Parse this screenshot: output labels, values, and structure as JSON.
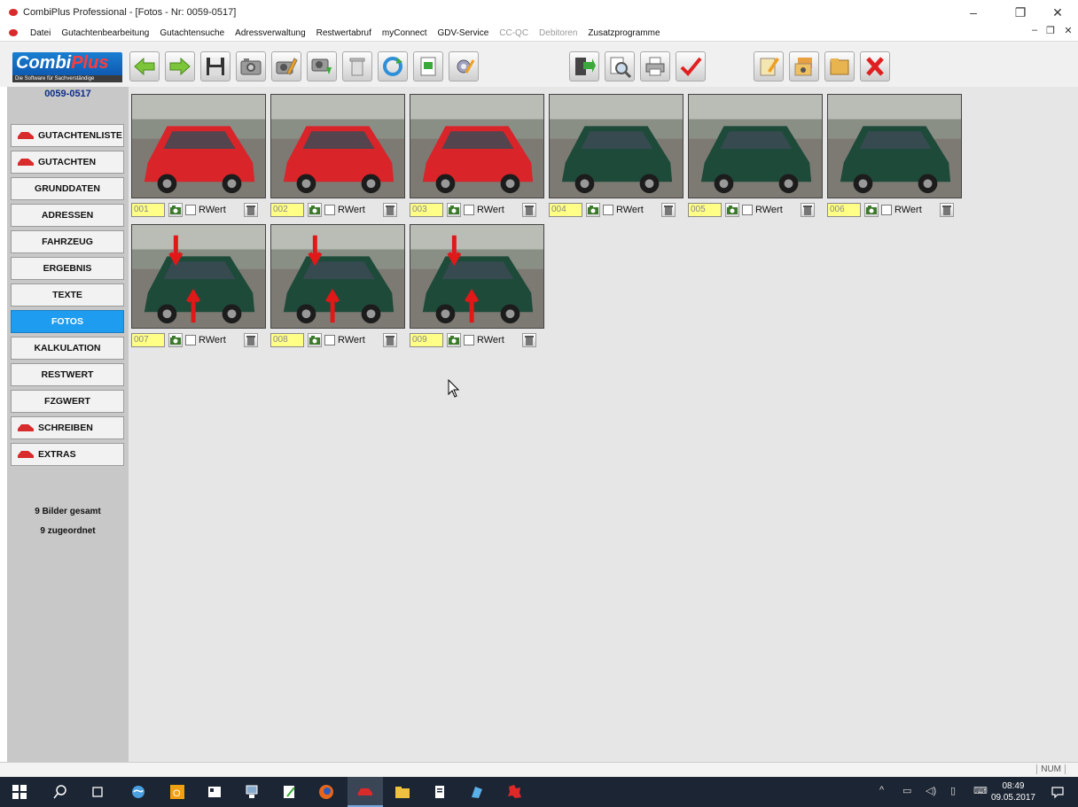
{
  "window": {
    "title": "CombiPlus Professional - [Fotos - Nr: 0059-0517]",
    "minimize": "–",
    "restore": "❐",
    "close": "✕"
  },
  "menu": {
    "items": [
      {
        "label": "Datei",
        "enabled": true
      },
      {
        "label": "Gutachtenbearbeitung",
        "enabled": true
      },
      {
        "label": "Gutachtensuche",
        "enabled": true
      },
      {
        "label": "Adressverwaltung",
        "enabled": true
      },
      {
        "label": "Restwertabruf",
        "enabled": true
      },
      {
        "label": "myConnect",
        "enabled": true
      },
      {
        "label": "GDV-Service",
        "enabled": true
      },
      {
        "label": "CC-QC",
        "enabled": false
      },
      {
        "label": "Debitoren",
        "enabled": false
      },
      {
        "label": "Zusatzprogramme",
        "enabled": true
      }
    ],
    "mdi_min": "–",
    "mdi_restore": "❐",
    "mdi_close": "✕"
  },
  "logo": {
    "word1": "Combi",
    "word2": "Plus",
    "tagline": "Die Software für Sachverständige"
  },
  "sidebar": {
    "case_number": "0059-0517",
    "items": [
      {
        "label": "GUTACHTENLISTE",
        "arrow": true,
        "active": false
      },
      {
        "label": "GUTACHTEN",
        "arrow": true,
        "active": false
      },
      {
        "label": "GRUNDDATEN",
        "arrow": false,
        "active": false
      },
      {
        "label": "ADRESSEN",
        "arrow": false,
        "active": false
      },
      {
        "label": "FAHRZEUG",
        "arrow": false,
        "active": false
      },
      {
        "label": "ERGEBNIS",
        "arrow": false,
        "active": false
      },
      {
        "label": "TEXTE",
        "arrow": false,
        "active": false
      },
      {
        "label": "FOTOS",
        "arrow": false,
        "active": true
      },
      {
        "label": "KALKULATION",
        "arrow": false,
        "active": false
      },
      {
        "label": "RESTWERT",
        "arrow": false,
        "active": false
      },
      {
        "label": "FZGWERT",
        "arrow": false,
        "active": false
      },
      {
        "label": "SCHREIBEN",
        "arrow": true,
        "active": false
      },
      {
        "label": "EXTRAS",
        "arrow": true,
        "active": false
      }
    ],
    "stats": {
      "total": "9 Bilder gesamt",
      "assigned": "9 zugeordnet"
    }
  },
  "photos": {
    "rwert_label": "RWert",
    "items": [
      {
        "number": "001",
        "rwert": false,
        "car_color": "#d9242a"
      },
      {
        "number": "002",
        "rwert": false,
        "car_color": "#d9242a"
      },
      {
        "number": "003",
        "rwert": false,
        "car_color": "#d9242a"
      },
      {
        "number": "004",
        "rwert": false,
        "car_color": "#1e4a3a"
      },
      {
        "number": "005",
        "rwert": false,
        "car_color": "#1e4a3a"
      },
      {
        "number": "006",
        "rwert": false,
        "car_color": "#1e4a3a"
      },
      {
        "number": "007",
        "rwert": false,
        "car_color": "#1e4a3a"
      },
      {
        "number": "008",
        "rwert": false,
        "car_color": "#1e4a3a"
      },
      {
        "number": "009",
        "rwert": false,
        "car_color": "#1e4a3a"
      }
    ]
  },
  "statusbar": {
    "num_indicator": "NUM"
  },
  "taskbar": {
    "time": "08:49",
    "date": "09.05.2017"
  },
  "colors": {
    "active_nav": "#1e9cf0",
    "number_field": "#ffff88",
    "case_number": "#0f2c8a"
  }
}
